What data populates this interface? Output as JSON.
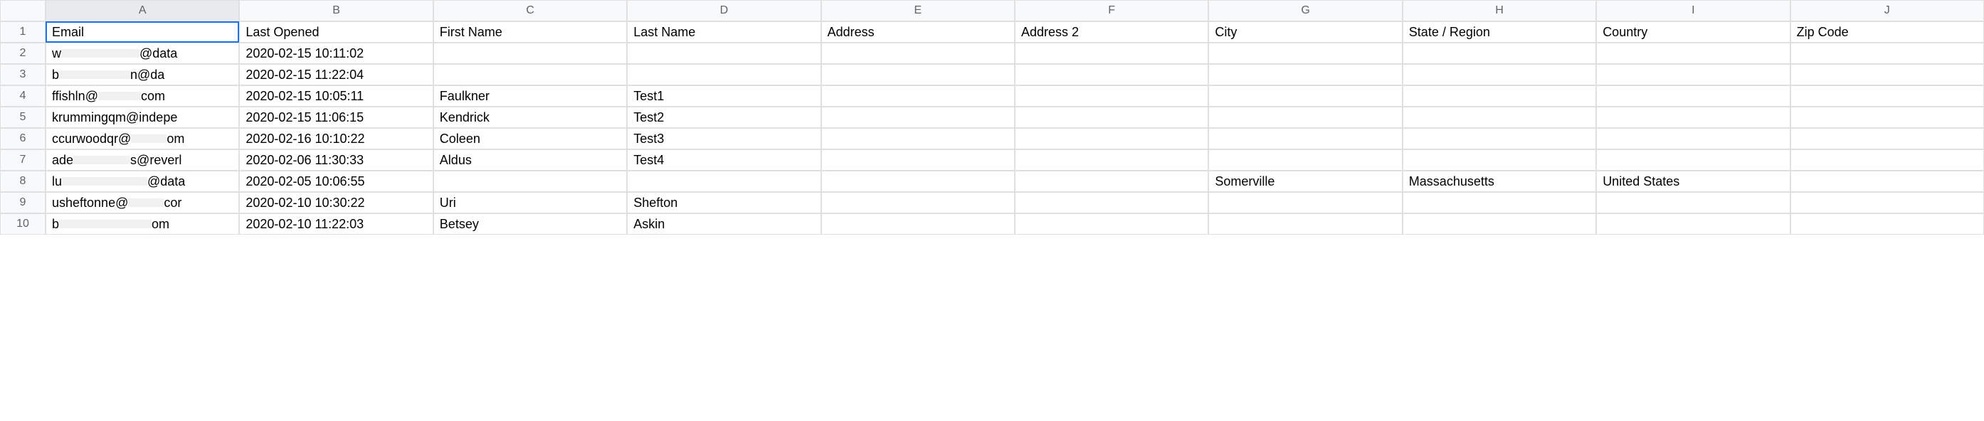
{
  "columns": [
    "A",
    "B",
    "C",
    "D",
    "E",
    "F",
    "G",
    "H",
    "I",
    "J"
  ],
  "rowNumbers": [
    "1",
    "2",
    "3",
    "4",
    "5",
    "6",
    "7",
    "8",
    "9",
    "10"
  ],
  "headers": {
    "A": "Email",
    "B": "Last Opened",
    "C": "First Name",
    "D": "Last Name",
    "E": "Address",
    "F": "Address 2",
    "G": "City",
    "H": "State / Region",
    "I": "Country",
    "J": "Zip Code"
  },
  "rows": [
    {
      "A_prefix": "w",
      "A_suffix": "@data",
      "B": "2020-02-15 10:11:02",
      "C": "",
      "D": "",
      "E": "",
      "F": "",
      "G": "",
      "H": "",
      "I": "",
      "J": ""
    },
    {
      "A_prefix": "b",
      "A_suffix": "n@da",
      "B": "2020-02-15 11:22:04",
      "C": "",
      "D": "",
      "E": "",
      "F": "",
      "G": "",
      "H": "",
      "I": "",
      "J": ""
    },
    {
      "A_prefix": "ffishln@",
      "A_suffix": "com",
      "B": "2020-02-15 10:05:11",
      "C": "Faulkner",
      "D": "Test1",
      "E": "",
      "F": "",
      "G": "",
      "H": "",
      "I": "",
      "J": ""
    },
    {
      "A_prefix": "krummingqm@indepe",
      "A_suffix": "",
      "B": "2020-02-15 11:06:15",
      "C": "Kendrick",
      "D": "Test2",
      "E": "",
      "F": "",
      "G": "",
      "H": "",
      "I": "",
      "J": ""
    },
    {
      "A_prefix": "ccurwoodqr@",
      "A_suffix": "om",
      "B": "2020-02-16 10:10:22",
      "C": "Coleen",
      "D": "Test3",
      "E": "",
      "F": "",
      "G": "",
      "H": "",
      "I": "",
      "J": ""
    },
    {
      "A_prefix": "ade",
      "A_suffix": "s@reverl",
      "B": "2020-02-06 11:30:33",
      "C": "Aldus",
      "D": "Test4",
      "E": "",
      "F": "",
      "G": "",
      "H": "",
      "I": "",
      "J": ""
    },
    {
      "A_prefix": "lu",
      "A_suffix": "@data",
      "B": "2020-02-05 10:06:55",
      "C": "",
      "D": "",
      "E": "",
      "F": "",
      "G": "Somerville",
      "H": "Massachusetts",
      "I": "United States",
      "J": ""
    },
    {
      "A_prefix": "usheftonne@",
      "A_suffix": "cor",
      "B": "2020-02-10 10:30:22",
      "C": "Uri",
      "D": "Shefton",
      "E": "",
      "F": "",
      "G": "",
      "H": "",
      "I": "",
      "J": ""
    },
    {
      "A_prefix": "b",
      "A_suffix": "om",
      "B": "2020-02-10 11:22:03",
      "C": "Betsey",
      "D": "Askin",
      "E": "",
      "F": "",
      "G": "",
      "H": "",
      "I": "",
      "J": ""
    }
  ],
  "redactedWidths": [
    110,
    100,
    60,
    0,
    50,
    80,
    120,
    50,
    130
  ]
}
